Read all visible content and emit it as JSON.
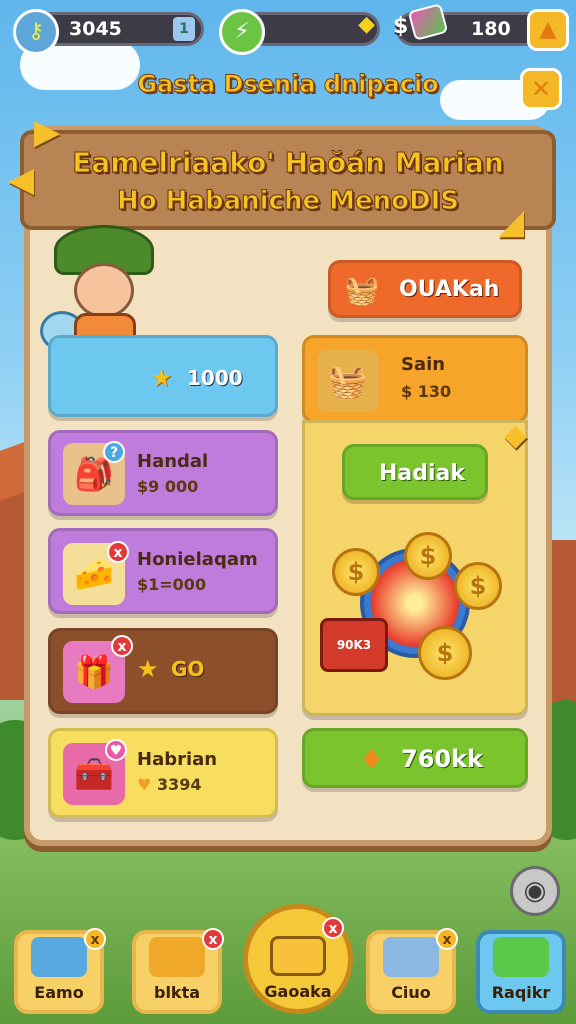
{
  "top_bar": {
    "coins_value": "3045",
    "energy_value": "",
    "gems_value": "180",
    "dollar_symbol": "$"
  },
  "sub_title": "Gasta Dsenia dnipacio",
  "banner": {
    "line1": "Eamelriaako' Haŏán Marian",
    "line2": "Ho Habaniche MenoDIS"
  },
  "left_cards": [
    {
      "label": "",
      "price": "1000"
    },
    {
      "label": "Handal",
      "price": "$9 000"
    },
    {
      "label": "Honielaqam",
      "price": "$1=000"
    },
    {
      "label": "",
      "price": "GO"
    },
    {
      "label": "Habrian",
      "price": "3394"
    }
  ],
  "right": {
    "orange_button_label": "OUAKah",
    "sale_label": "Sain",
    "sale_price": "$ 130",
    "green_button_label": "Hadiak",
    "chest_label": "90K3",
    "big_button_label": "760kk"
  },
  "nav": [
    {
      "label": "Eamo"
    },
    {
      "label": "blkta"
    },
    {
      "label": "Gaoaka"
    },
    {
      "label": "Ciuo"
    },
    {
      "label": "Raqikr"
    }
  ],
  "colors": {
    "accent_yellow": "#f7c41f",
    "panel_bg": "#f2e2c2",
    "banner_bg": "#b88454",
    "green_button": "#7cc42e",
    "orange_button": "#ef6a2a"
  }
}
